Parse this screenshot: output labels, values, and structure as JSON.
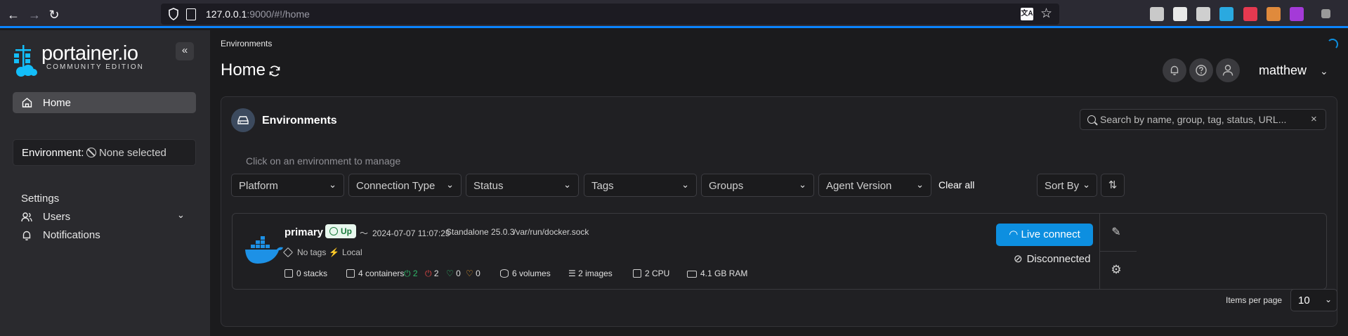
{
  "browser": {
    "back": "←",
    "forward": "→",
    "reload": "↻",
    "url_host": "127.0.0.1",
    "url_rest": ":9000/#!/home",
    "translate_glyph": "文A",
    "star_glyph": "☆",
    "extension_colors": [
      "#c9c9c9",
      "#e8e8e8",
      "#cfcfcf",
      "#2aa9e0",
      "#e53950",
      "#e08a3c",
      "#a43ad8",
      "#9a9a9a"
    ]
  },
  "sidebar": {
    "logo_text": "portainer.io",
    "logo_sub": "COMMUNITY EDITION",
    "collapse_glyph": "«",
    "home_label": "Home",
    "environment_label": "Environment:",
    "environment_value": "None selected",
    "settings_label": "Settings",
    "users_label": "Users",
    "users_chevron": "⌄",
    "notifications_label": "Notifications"
  },
  "header": {
    "breadcrumb": "Environments",
    "title": "Home",
    "user_name": "matthew",
    "user_chevron": "⌄"
  },
  "panel": {
    "title": "Environments",
    "search_placeholder": "Search by name, group, tag, status, URL...",
    "search_clear": "×",
    "hint": "Click on an environment to manage",
    "filters": [
      "Platform",
      "Connection Type",
      "Status",
      "Tags",
      "Groups",
      "Agent Version"
    ],
    "filter_chevron": "⌄",
    "clear_all": "Clear all",
    "sort_by": "Sort By",
    "sort_order_glyph": "⇅"
  },
  "environment": {
    "name": "primary",
    "status": "Up",
    "heartbeat": "2024-07-07 11:07:25",
    "type": "Standalone 25.0.3",
    "socket": "/var/run/docker.sock",
    "tags": "No tags",
    "connection": "Local",
    "stacks": "0 stacks",
    "containers": "4 containers",
    "running": "2",
    "stopped": "2",
    "healthy": "0",
    "unhealthy": "0",
    "volumes": "6 volumes",
    "images": "2 images",
    "cpu": "2 CPU",
    "ram": "4.1 GB RAM",
    "live_connect": "Live connect",
    "disconnected": "Disconnected",
    "edit_glyph": "✎",
    "gear_glyph": "⚙"
  },
  "pagination": {
    "items_per_page_label": "Items per page",
    "items_per_page_value": "10",
    "chevron": "⌄"
  },
  "colors": {
    "accent": "#0d8fe0",
    "status_up_bg": "#e8f7ee",
    "status_up_text": "#1a7b3c",
    "running": "#2fb86a",
    "stopped": "#d74444",
    "unhealthy": "#e69a2e"
  }
}
